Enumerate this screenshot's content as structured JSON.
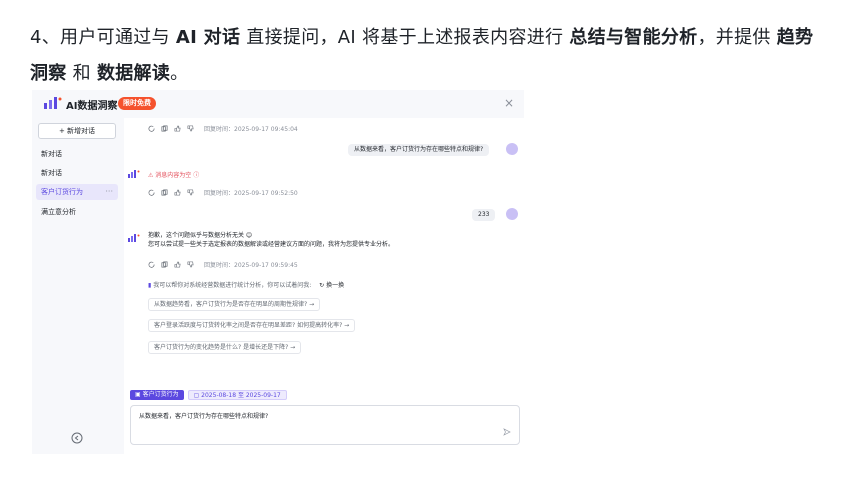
{
  "doc": {
    "p1": "4、用户可通过与 ",
    "b1": "AI 对话",
    "p2": " 直接提问，AI 将基于上述报表内容进行 ",
    "b2": "总结与智能分析",
    "p3": "，并提供 ",
    "b3": "趋势洞察",
    "p4": " 和 ",
    "b4": "数据解读",
    "p5": "。"
  },
  "app": {
    "title": "AI数据洞察",
    "badge": "限时免费",
    "close": "×"
  },
  "sidebar": {
    "new_chat": "+ 新增对话",
    "items": [
      {
        "label": "新对话"
      },
      {
        "label": "新对话"
      },
      {
        "label": "客户订货行为",
        "more": "···"
      },
      {
        "label": "满立意分析"
      }
    ]
  },
  "chat": {
    "tools_time_1": "回复时间：2025-09-17 09:45:04",
    "user_msg_1": "从数据来看，客户订货行为存在哪些特点和规律?",
    "error_text": "消息内容为空",
    "tools_time_2": "回复时间：2025-09-17 09:52:50",
    "user_msg_2": "233",
    "ai_reply_1": "抱歉，这个问题似乎与数据分析无关 😊",
    "ai_reply_2": "您可以尝试提一些关于选定报表的数据解读或经营建议方面的问题，我将为您提供专业分析。",
    "tools_time_3": "回复时间：2025-09-17 09:59:45",
    "suggest_title": "我可以帮你对系统经营数据进行统计分析，你可以试着问我:",
    "refresh": "换一换",
    "suggestions": [
      "从数据趋势看，客户订货行为是否存在明显的周期性规律? →",
      "客户登录活跃度与订货转化率之间是否存在明显差距? 如何提高转化率? →",
      "客户订货行为的变化趋势是什么? 是增长还是下降? →"
    ],
    "tag": "客户订货行为",
    "date_range": "2025-08-18 至 2025-09-17",
    "input_value": "从数据来看，客户订货行为存在哪些特点和规律?"
  },
  "colors": {
    "accent": "#5b48e0",
    "badge": "#f5522d",
    "error": "#e34d59"
  }
}
